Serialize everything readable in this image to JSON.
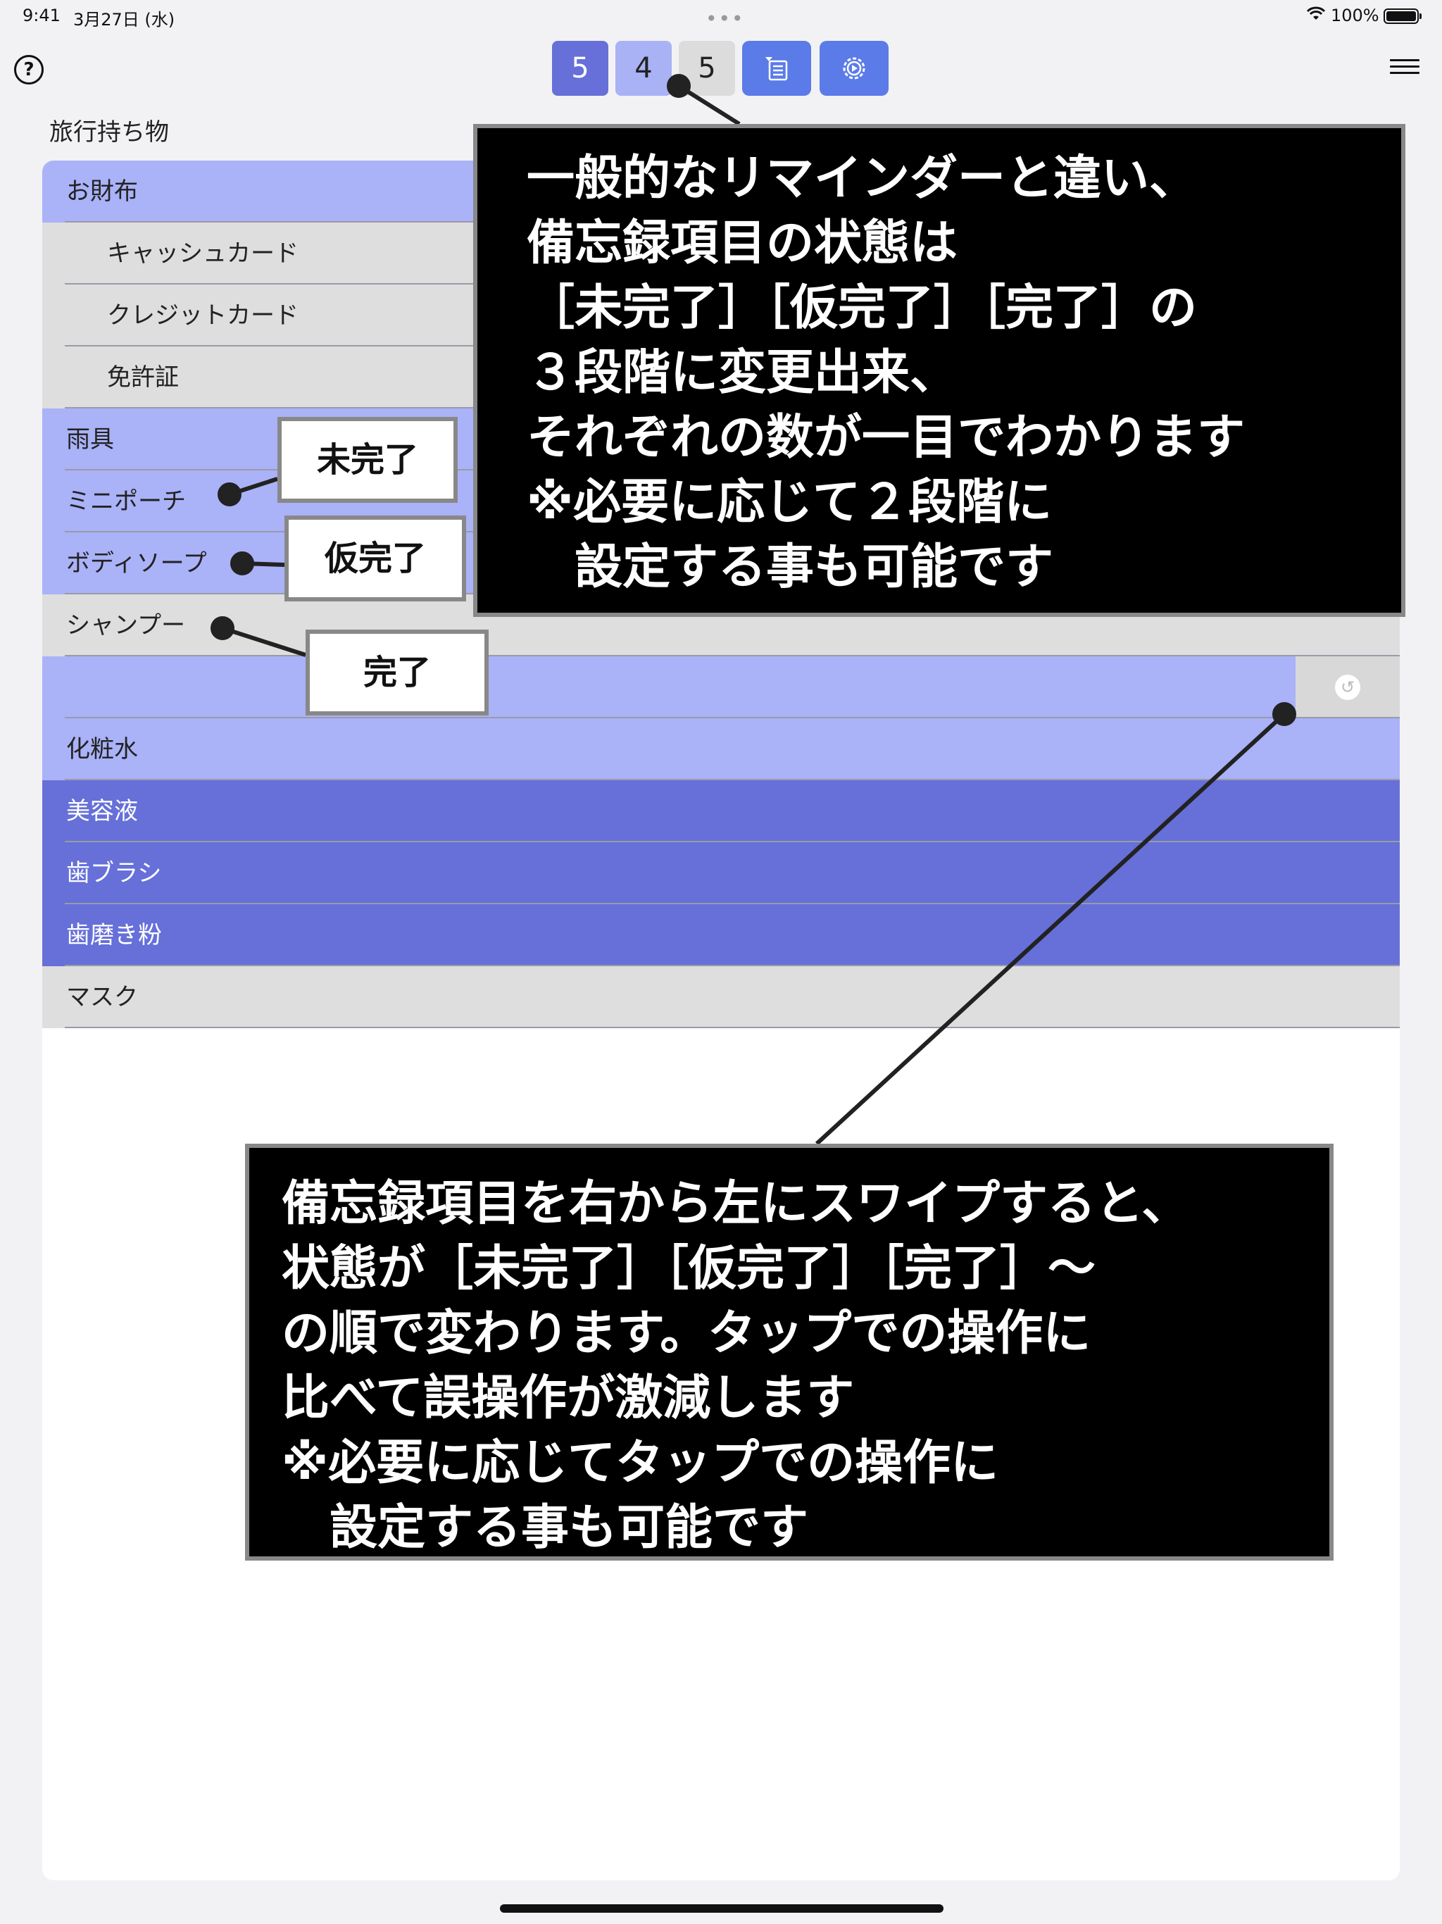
{
  "status_bar": {
    "time": "9:41",
    "date": "3月27日 (水)",
    "more": "•••",
    "battery": "100%"
  },
  "toolbar": {
    "help_icon": "?",
    "counts": {
      "incomplete": "5",
      "provisional": "4",
      "complete": "5"
    },
    "icons": [
      "list-edit-icon",
      "gear-icon",
      "menu-icon"
    ]
  },
  "list": {
    "title": "旅行持ち物",
    "items": [
      {
        "label": "お財布",
        "state": "light"
      },
      {
        "label": "キャッシュカード",
        "state": "gray",
        "indent": true
      },
      {
        "label": "クレジットカード",
        "state": "gray",
        "indent": true
      },
      {
        "label": "免許証",
        "state": "gray",
        "indent": true
      },
      {
        "label": "雨具",
        "state": "light"
      },
      {
        "label": "ミニポーチ",
        "state": "light"
      },
      {
        "label": "ボディソープ",
        "state": "light"
      },
      {
        "label": "シャンプー",
        "state": "gray"
      },
      {
        "label": "",
        "state": "light",
        "swiped": true
      },
      {
        "label": "化粧水",
        "state": "light"
      },
      {
        "label": "美容液",
        "state": "dark"
      },
      {
        "label": "歯ブラシ",
        "state": "dark"
      },
      {
        "label": "歯磨き粉",
        "state": "dark"
      },
      {
        "label": "マスク",
        "state": "gray"
      }
    ]
  },
  "annotations": {
    "top_callout": "一般的なリマインダーと違い、\n備忘録項目の状態は\n［未完了］［仮完了］［完了］の\n３段階に変更出来、\nそれぞれの数が一目でわかります\n※必要に応じて２段階に\n　設定する事も可能です",
    "bottom_callout": "備忘録項目を右から左にスワイプすると、\n状態が［未完了］［仮完了］［完了］〜\nの順で変わります。タップでの操作に\n比べて誤操作が激減します\n※必要に応じてタップでの操作に\n　設定する事も可能です",
    "tag_incomplete": "未完了",
    "tag_provisional": "仮完了",
    "tag_complete": "完了"
  },
  "colors": {
    "incomplete": "#6670d8",
    "provisional": "#aab2f8",
    "complete": "#dedede",
    "tool_button": "#5b7be8"
  }
}
